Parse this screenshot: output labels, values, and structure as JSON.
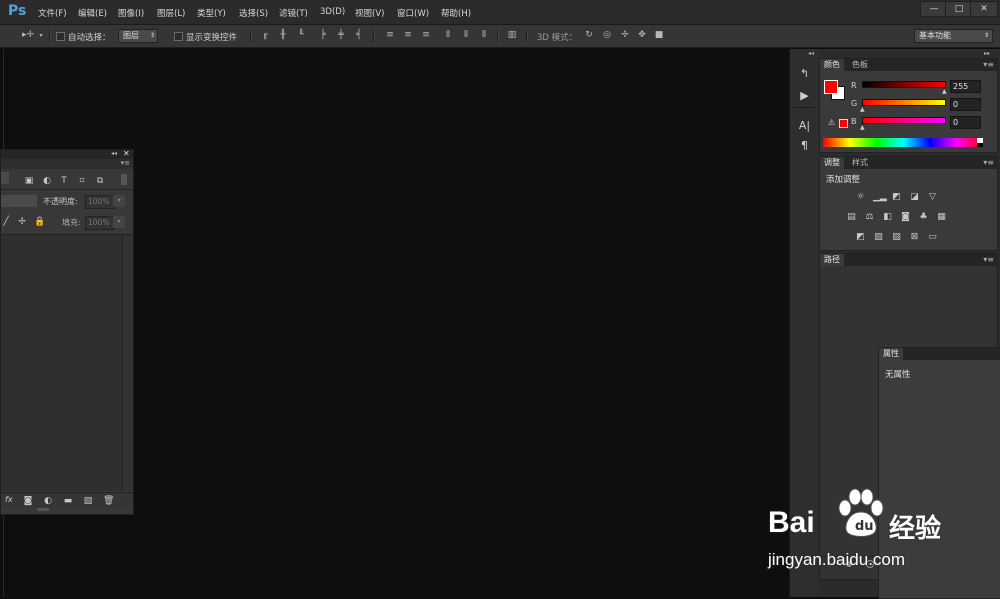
{
  "app": {
    "logo": "Ps",
    "menu": [
      "文件(F)",
      "编辑(E)",
      "图像(I)",
      "图层(L)",
      "类型(Y)",
      "选择(S)",
      "滤镜(T)",
      "3D(D)",
      "视图(V)",
      "窗口(W)",
      "帮助(H)"
    ],
    "window_controls": [
      "—",
      "□",
      "✕"
    ]
  },
  "options": {
    "auto_select_label": "自动选择：",
    "auto_select_target": "图层",
    "show_transform_label": "显示变换控件",
    "mode_3d_label": "3D 模式：",
    "workspace": "基本功能"
  },
  "color_panel": {
    "tabs": [
      "颜色",
      "色板"
    ],
    "channels": [
      {
        "label": "R",
        "value": "255"
      },
      {
        "label": "G",
        "value": "0"
      },
      {
        "label": "B",
        "value": "0"
      }
    ],
    "foreground": "#ff0000",
    "background": "#ffffff"
  },
  "adjust_panel": {
    "tabs": [
      "调整",
      "样式"
    ],
    "title": "添加调整"
  },
  "paths_panel": {
    "tabs": [
      "路径"
    ]
  },
  "properties_panel": {
    "tabs": [
      "属性"
    ],
    "empty_text": "无属性"
  },
  "layers_panel": {
    "opacity_label": "不透明度:",
    "opacity_value": "100%",
    "fill_label": "填充:",
    "fill_value": "100%",
    "footer_fx": "fx"
  },
  "watermark": {
    "brand": "Bai",
    "brand_cn": "经验",
    "url": "jingyan.baidu.com"
  }
}
